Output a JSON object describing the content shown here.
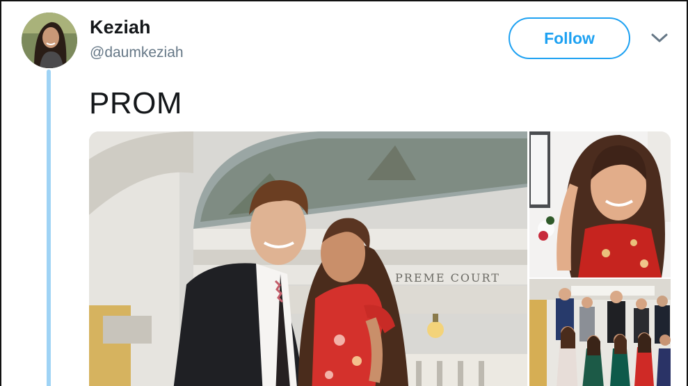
{
  "user": {
    "display_name": "Keziah",
    "handle": "@daumkeziah",
    "avatar_alt": "profile photo"
  },
  "actions": {
    "follow_label": "Follow",
    "menu_icon": "chevron-down-icon"
  },
  "tweet": {
    "text": "PROM"
  },
  "media": {
    "main_sign_text": "PREME COURT",
    "photos": [
      {
        "alt": "couple at prom in capitol rotunda"
      },
      {
        "alt": "girl in red dress smiling"
      },
      {
        "alt": "prom group photo on staircase"
      }
    ]
  },
  "colors": {
    "accent": "#1da1f2",
    "thread_line": "#9fd3f5",
    "handle_gray": "#657786"
  }
}
